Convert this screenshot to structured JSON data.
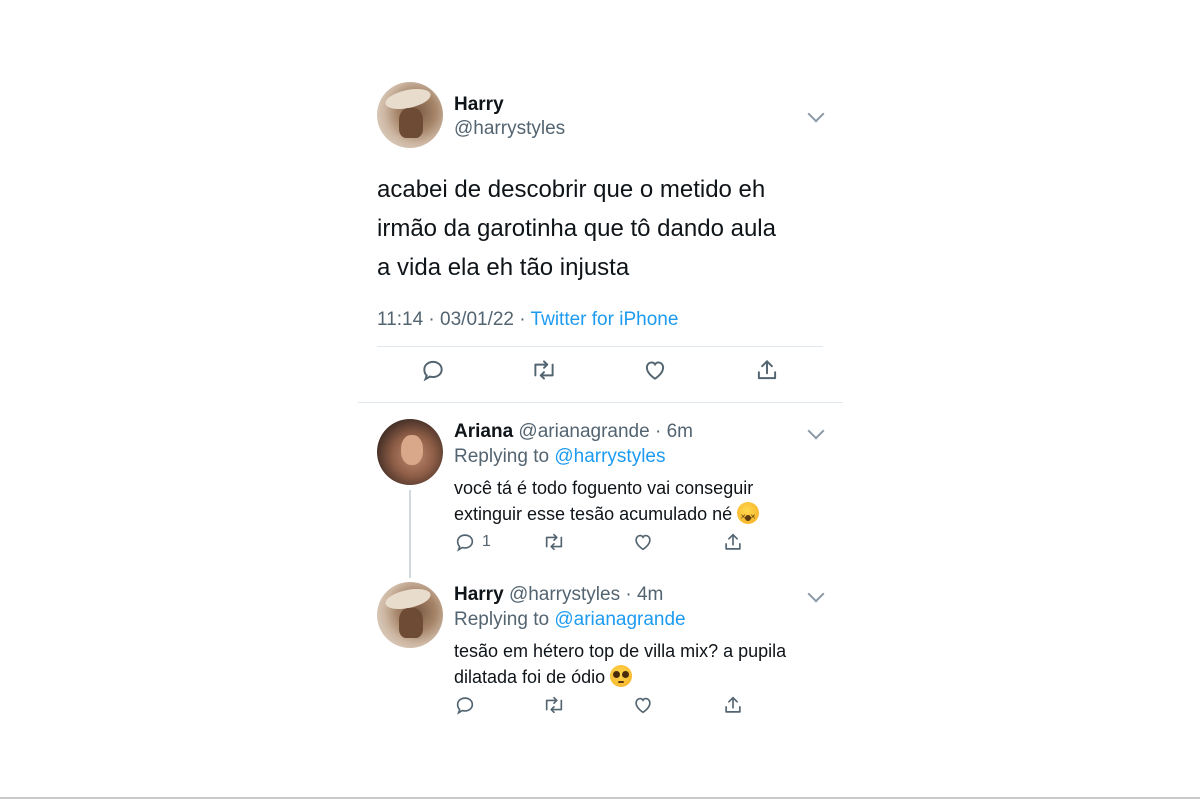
{
  "main_tweet": {
    "name": "Harry",
    "handle": "@harrystyles",
    "text_lines": [
      "acabei de descobrir que o metido eh",
      "irmão da garotinha que tô dando aula",
      "a vida ela eh tão injusta"
    ],
    "time": "11:14",
    "date": "03/01/22",
    "source": "Twitter for iPhone",
    "avatar_icon": "harry-avatar",
    "actions": [
      "reply-icon",
      "retweet-icon",
      "like-icon",
      "share-icon"
    ]
  },
  "replies": [
    {
      "name": "Ariana",
      "handle": "@arianagrande",
      "age": "6m",
      "replying_prefix": "Replying to",
      "replying_to": "@harrystyles",
      "text_lines": [
        "você tá é todo foguento vai conseguir",
        "extinguir esse tesão acumulado né"
      ],
      "emoji": "dizzy-face-emoji",
      "reply_count": "1",
      "avatar_icon": "ariana-avatar"
    },
    {
      "name": "Harry",
      "handle": "@harrystyles",
      "age": "4m",
      "replying_prefix": "Replying to",
      "replying_to": "@arianagrande",
      "text_lines": [
        "tesão em hétero top de villa mix? a pupila",
        "dilatada foi de ódio"
      ],
      "emoji": "pleading-face-emoji",
      "reply_count": "",
      "avatar_icon": "harry-avatar"
    }
  ],
  "colors": {
    "text": "#0f1419",
    "secondary": "#536471",
    "link": "#1d9bf0",
    "divider": "#e1e8ed"
  }
}
